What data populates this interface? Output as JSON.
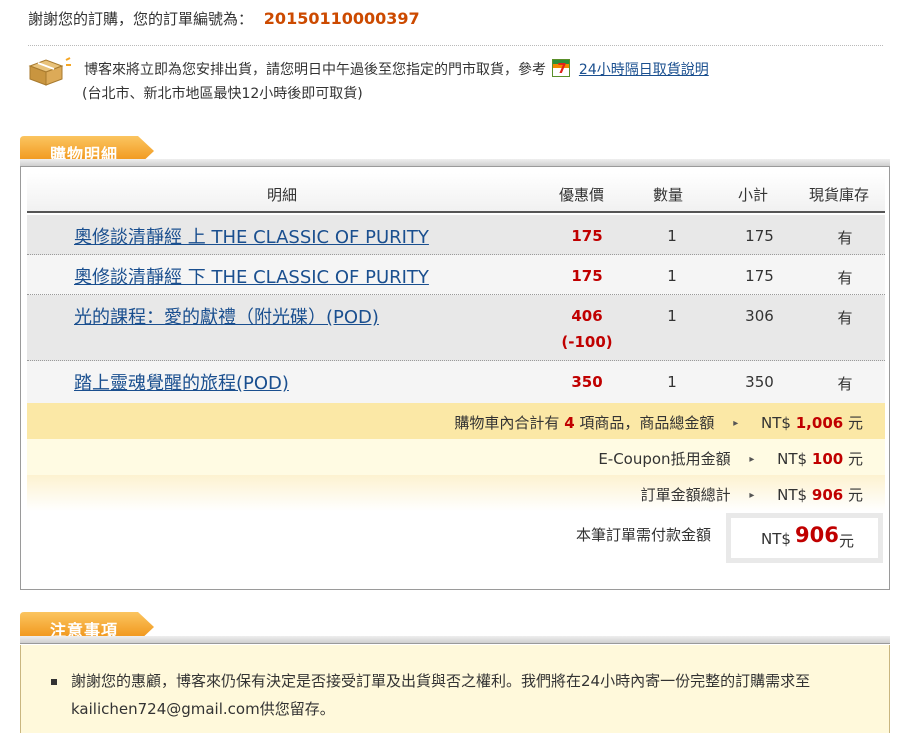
{
  "header": {
    "thanks_text": "謝謝您的訂購，您的訂單編號為：",
    "order_number": "20150110000397"
  },
  "shipping_notice": {
    "line1": "博客來將立即為您安排出貨，請您明日中午過後至您指定的門市取貨，參考",
    "link_text": "24小時隔日取貨說明",
    "line2": "(台北市、新北市地區最快12小時後即可取貨)"
  },
  "cart_section": {
    "title": "購物明細",
    "columns": [
      "明細",
      "優惠價",
      "數量",
      "小計",
      "現貨庫存"
    ],
    "items": [
      {
        "name": "奧修談清靜經 上 THE CLASSIC OF PURITY",
        "price": "175",
        "discount": "",
        "qty": "1",
        "subtotal": "175",
        "stock": "有"
      },
      {
        "name": "奧修談清靜經 下 THE CLASSIC OF PURITY",
        "price": "175",
        "discount": "",
        "qty": "1",
        "subtotal": "175",
        "stock": "有"
      },
      {
        "name": "光的課程：愛的獻禮（附光碟）(POD)",
        "price": "406",
        "discount": "(-100)",
        "qty": "1",
        "subtotal": "306",
        "stock": "有"
      },
      {
        "name": "踏上靈魂覺醒的旅程(POD)",
        "price": "350",
        "discount": "",
        "qty": "1",
        "subtotal": "350",
        "stock": "有"
      }
    ],
    "summary": {
      "cart_prefix": "購物車內合計有",
      "item_count": "4",
      "cart_suffix": "項商品，商品總金額",
      "cart_total_currency": "NT$",
      "cart_total": "1,006",
      "unit": "元",
      "coupon_label": "E-Coupon抵用金額",
      "coupon_currency": "NT$",
      "coupon_amount": "100",
      "order_total_label": "訂單金額總計",
      "order_total_currency": "NT$",
      "order_total": "906",
      "payable_label": "本筆訂單需付款金額",
      "payable_currency": "NT$",
      "payable_amount": "906"
    }
  },
  "notes_section": {
    "title": "注意事項",
    "items": [
      "謝謝您的惠顧，博客來仍保有決定是否接受訂單及出貨與否之權利。我們將在24小時內寄一份完整的訂購需求至kailichen724@gmail.com供您留存。"
    ]
  },
  "colors": {
    "accent_orange": "#f5a623",
    "price_red": "#c00000",
    "order_number_orange": "#cc4a00",
    "link_blue": "#1a4f8f"
  }
}
